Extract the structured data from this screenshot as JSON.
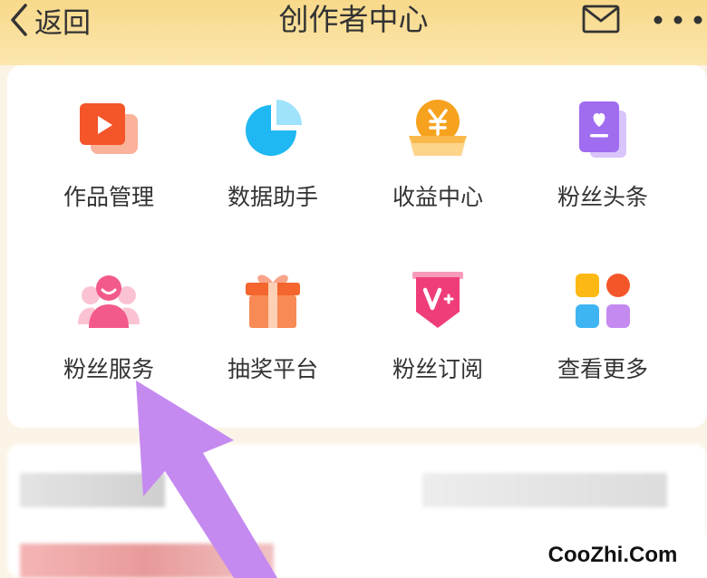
{
  "header": {
    "back_label": "返回",
    "title": "创作者中心"
  },
  "grid": {
    "items": [
      {
        "label": "作品管理",
        "icon": "video-icon"
      },
      {
        "label": "数据助手",
        "icon": "pie-chart-icon"
      },
      {
        "label": "收益中心",
        "icon": "yuan-coin-icon"
      },
      {
        "label": "粉丝头条",
        "icon": "heart-book-icon"
      },
      {
        "label": "粉丝服务",
        "icon": "fans-user-icon"
      },
      {
        "label": "抽奖平台",
        "icon": "gift-box-icon"
      },
      {
        "label": "粉丝订阅",
        "icon": "v-badge-icon"
      },
      {
        "label": "查看更多",
        "icon": "app-grid-icon"
      }
    ]
  },
  "watermark": "CooZhi.Com",
  "colors": {
    "header_bg": "#f8d98a",
    "arrow": "#c58af0",
    "video": "#f4562a",
    "pie": "#1fb8f2",
    "coin": "#f6a21e",
    "book": "#a06cf0",
    "fans": "#f25a8a",
    "gift": "#f4662e",
    "vbadge": "#ef3d7a"
  }
}
